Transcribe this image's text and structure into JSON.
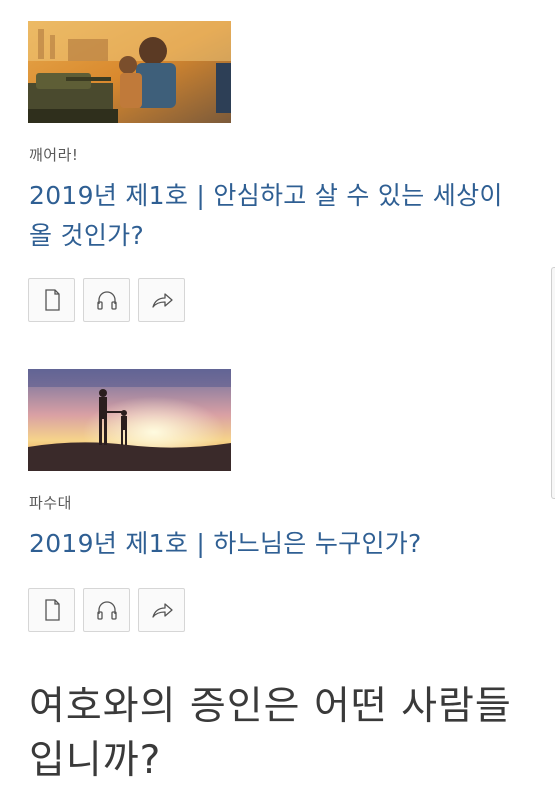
{
  "articles": [
    {
      "publication": "깨어라!",
      "title": "2019년 제1호 | 안심하고 살 수 있는 세상이 올 것인가?",
      "image_icon": "awake-cover-illustration",
      "actions": [
        {
          "icon": "document-icon",
          "label": "read"
        },
        {
          "icon": "headphones-icon",
          "label": "listen"
        },
        {
          "icon": "share-icon",
          "label": "share"
        }
      ]
    },
    {
      "publication": "파수대",
      "title": "2019년 제1호 | 하느님은 누구인가?",
      "image_icon": "watchtower-cover-photo",
      "actions": [
        {
          "icon": "document-icon",
          "label": "read"
        },
        {
          "icon": "headphones-icon",
          "label": "listen"
        },
        {
          "icon": "share-icon",
          "label": "share"
        }
      ]
    }
  ],
  "section_heading": "여호와의 증인은 어떤 사람들입니까?",
  "colors": {
    "link": "#2f5f93",
    "publication": "#5a5a5a",
    "button_border": "#d6d6d6",
    "heading": "#3a3a3a"
  }
}
